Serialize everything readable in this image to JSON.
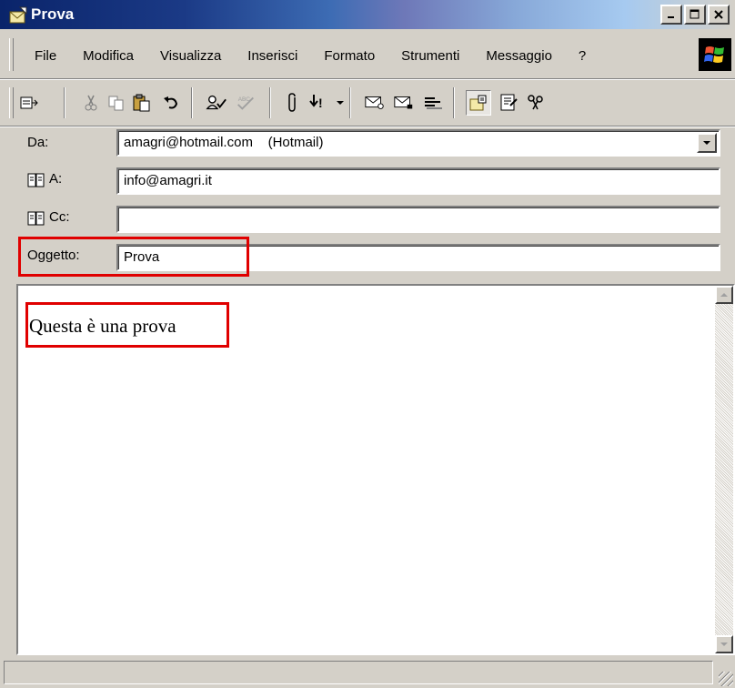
{
  "window": {
    "title": "Prova"
  },
  "menu": [
    "File",
    "Modifica",
    "Visualizza",
    "Inserisci",
    "Formato",
    "Strumenti",
    "Messaggio",
    "?"
  ],
  "toolbar": {
    "icons": [
      "send-icon",
      "cut-icon",
      "copy-icon",
      "paste-icon",
      "undo-icon",
      "check-names-icon",
      "spelling-icon",
      "attach-icon",
      "priority-icon",
      "priority-dropdown-icon",
      "sign-icon",
      "encrypt-icon",
      "offline-icon",
      "stationery-icon",
      "digital-id-icon",
      "encoding-icon"
    ]
  },
  "header": {
    "from_label": "Da:",
    "from_value": "amagri@hotmail.com    (Hotmail)",
    "to_label": "A:",
    "to_value": "info@amagri.it",
    "cc_label": "Cc:",
    "cc_value": "",
    "subject_label": "Oggetto:",
    "subject_value": "Prova"
  },
  "body": {
    "text": "Questa è una prova"
  },
  "colors": {
    "highlight": "#e00000",
    "titlebar_start": "#0a246a"
  }
}
